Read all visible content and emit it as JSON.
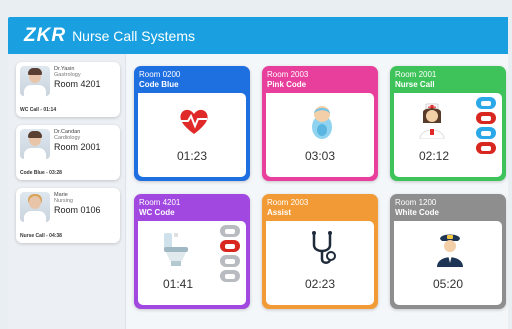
{
  "app": {
    "logo": "ZKR",
    "title": "Nurse Call Systems"
  },
  "sidebar": {
    "patients": [
      {
        "name": "Dr.Yasin",
        "dept": "Gastrology",
        "room": "Room 4201",
        "call": "WC Call - 01:14",
        "avatar": "male-doctor"
      },
      {
        "name": "Dr.Candan",
        "dept": "Cardiology",
        "room": "Room 2001",
        "call": "Code Blue - 03:28",
        "avatar": "male-doctor"
      },
      {
        "name": "Marie",
        "dept": "Nursing",
        "room": "Room 0106",
        "call": "Nurse Call - 04:38",
        "avatar": "female-nurse"
      }
    ]
  },
  "tiles": [
    {
      "room": "Room 0200",
      "code": "Code Blue",
      "time": "01:23",
      "color": "#1e6fe0",
      "icon": "heart-pulse-icon"
    },
    {
      "room": "Room 2003",
      "code": "Pink Code",
      "time": "03:03",
      "color": "#e83e9c",
      "icon": "baby-icon"
    },
    {
      "room": "Room 2001",
      "code": "Nurse Call",
      "time": "02:12",
      "color": "#3ec35a",
      "icon": "nurse-icon",
      "side_icons": [
        "bed-icon",
        "bath-icon",
        "shower-icon",
        "bed-icon"
      ],
      "side_colors": [
        "blue",
        "red",
        "blue",
        "red"
      ]
    },
    {
      "room": "Room 4201",
      "code": "WC Code",
      "time": "01:41",
      "color": "#a048e0",
      "icon": "toilet-icon",
      "side_icons": [
        "bed-icon",
        "bath-icon",
        "shower-icon",
        "shower-icon"
      ],
      "side_colors": [
        "gray",
        "red",
        "gray",
        "gray"
      ]
    },
    {
      "room": "Room 2003",
      "code": "Assist",
      "time": "02:23",
      "color": "#f29a35",
      "icon": "stethoscope-icon"
    },
    {
      "room": "Room 1200",
      "code": "White Code",
      "time": "05:20",
      "color": "#8e8e8e",
      "icon": "police-officer-icon"
    }
  ]
}
